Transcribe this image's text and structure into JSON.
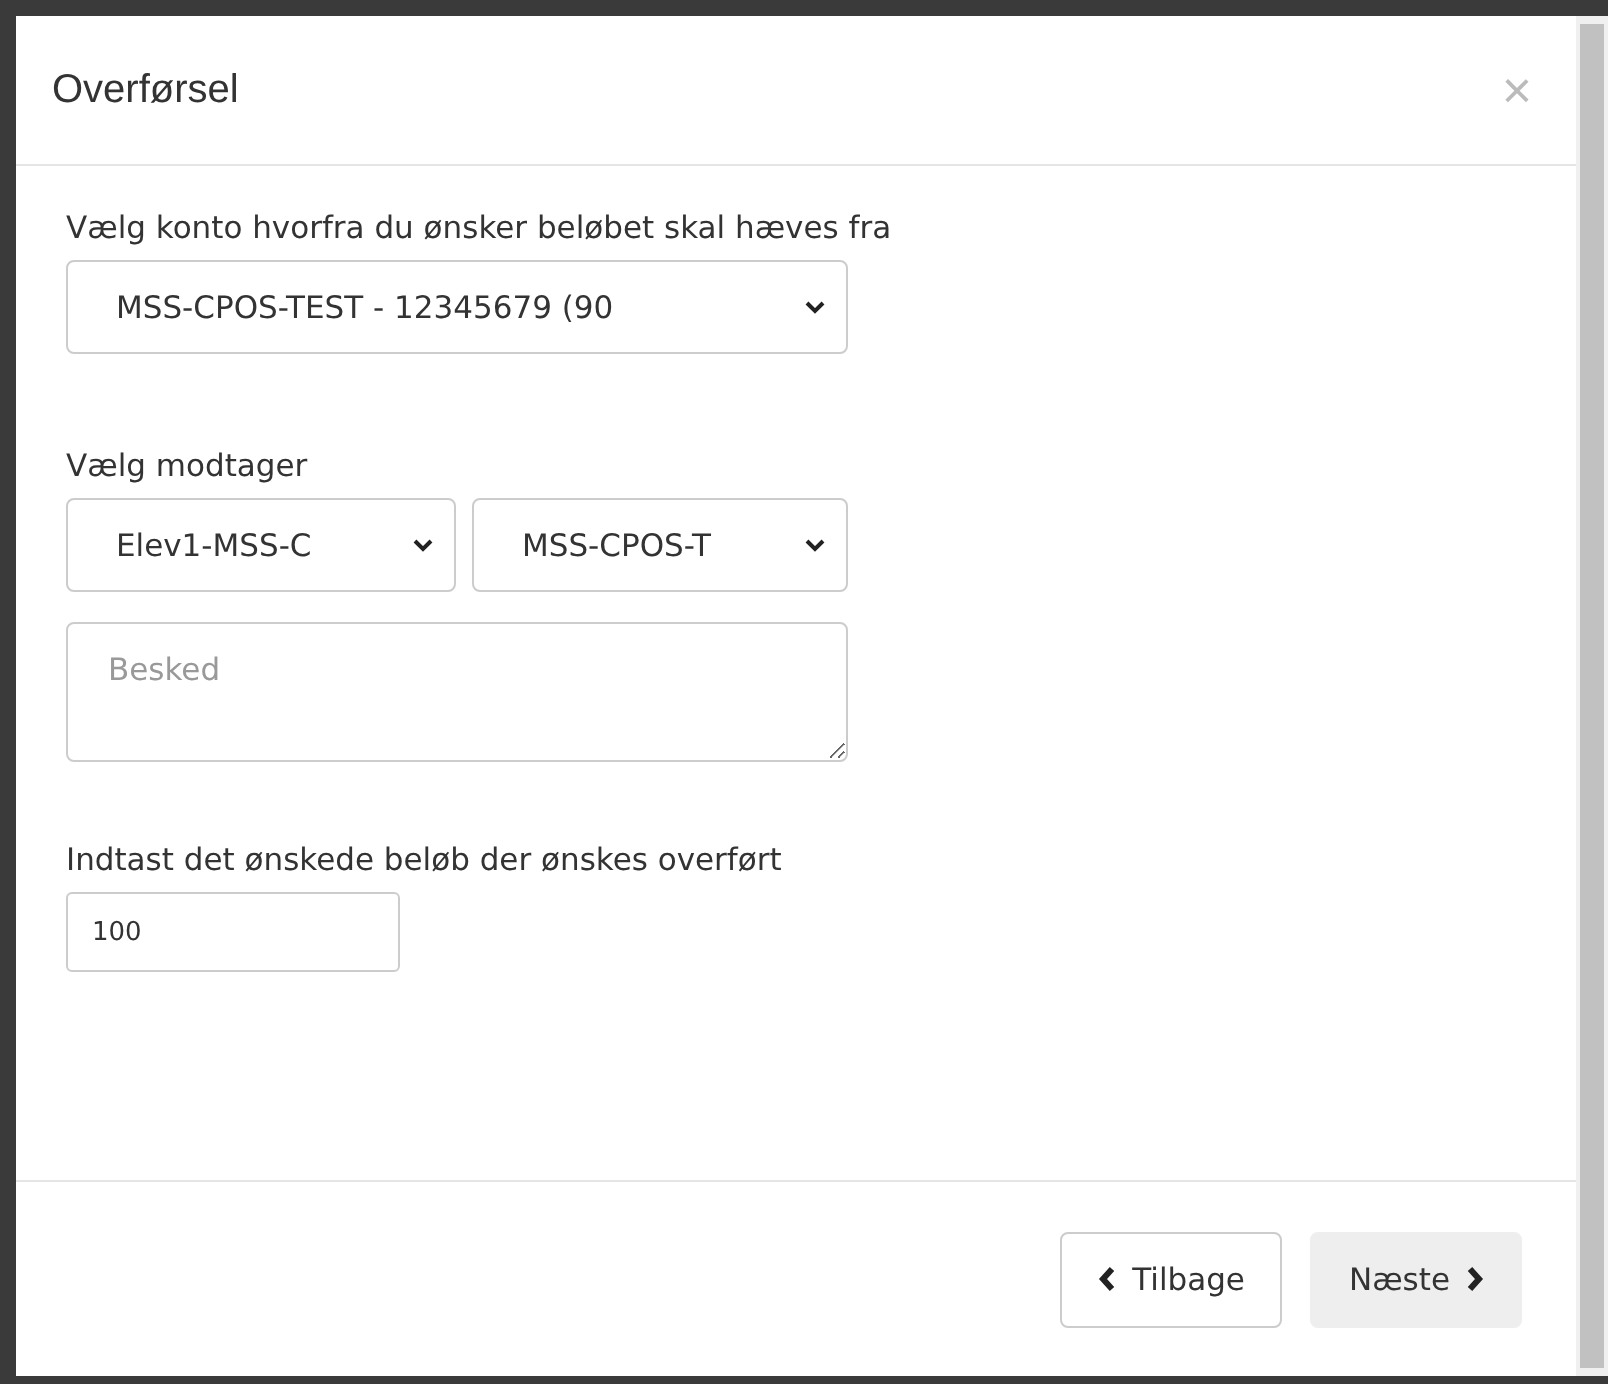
{
  "dialog": {
    "title": "Overførsel",
    "close": "×"
  },
  "source": {
    "label": "Vælg konto hvorfra du ønsker beløbet skal hæves fra",
    "value": "MSS-CPOS-TEST - 12345679 (90"
  },
  "recipient": {
    "label": "Vælg modtager",
    "selects": [
      "Elev1-MSS-C",
      "MSS-CPOS-T"
    ]
  },
  "message": {
    "placeholder": "Besked"
  },
  "amount": {
    "label": "Indtast det ønskede beløb der ønskes overført",
    "value": "100"
  },
  "buttons": [
    {
      "label": "Tilbage",
      "kind": "back"
    },
    {
      "label": "Næste",
      "kind": "next"
    }
  ]
}
